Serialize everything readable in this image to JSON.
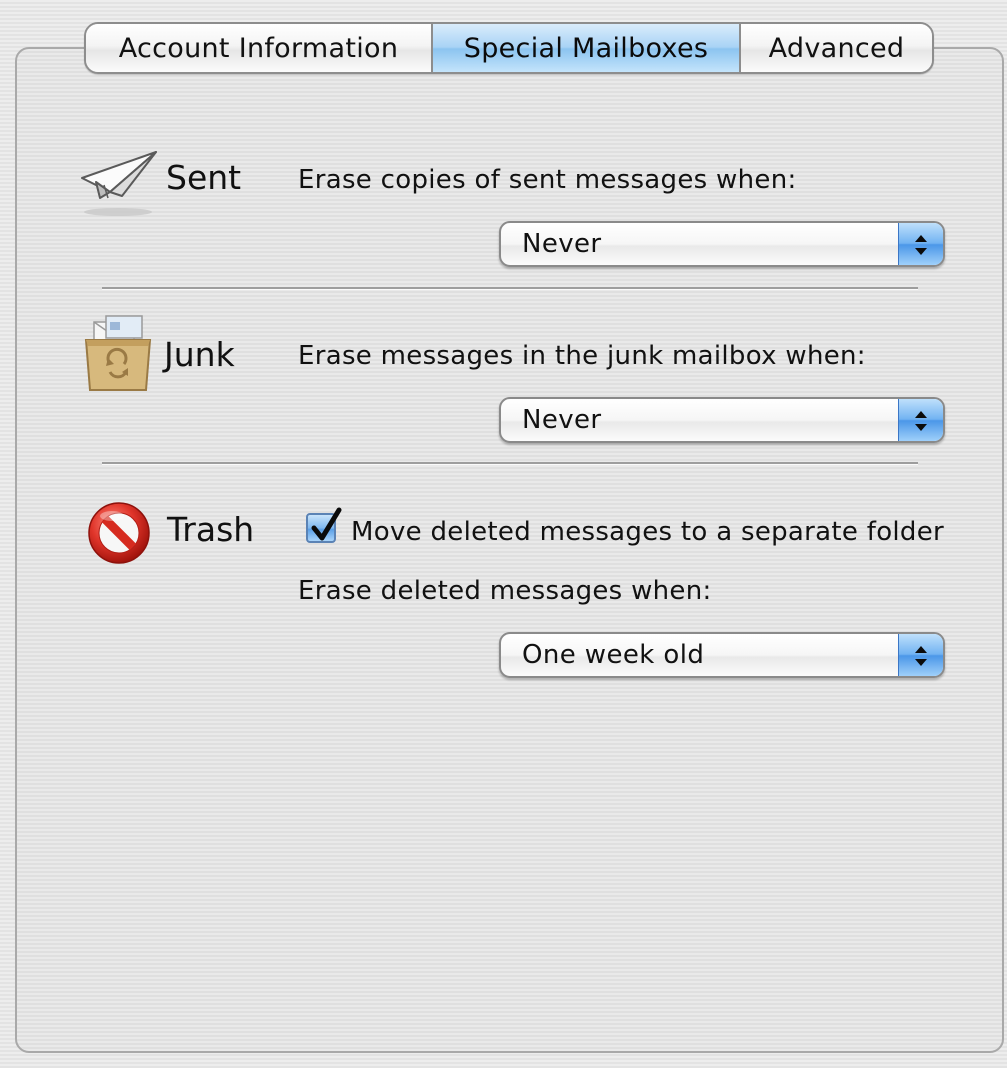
{
  "tabs": {
    "account": "Account Information",
    "special": "Special Mailboxes",
    "advanced": "Advanced",
    "selected": "Special Mailboxes"
  },
  "sent": {
    "label": "Sent",
    "icon": "paper-plane-icon",
    "prompt": "Erase copies of sent messages when:",
    "selected": "Never"
  },
  "junk": {
    "label": "Junk",
    "icon": "junk-mailbox-icon",
    "prompt": "Erase messages in the junk mailbox when:",
    "selected": "Never"
  },
  "trash": {
    "label": "Trash",
    "icon": "no-entry-icon",
    "checkbox_label": "Move deleted messages to a separate folder",
    "checkbox_checked": true,
    "prompt": "Erase deleted messages when:",
    "selected": "One week old"
  },
  "colors": {
    "accent_blue": "#4b97e8",
    "trash_red": "#d62b20",
    "junk_tan": "#d7b97d"
  }
}
